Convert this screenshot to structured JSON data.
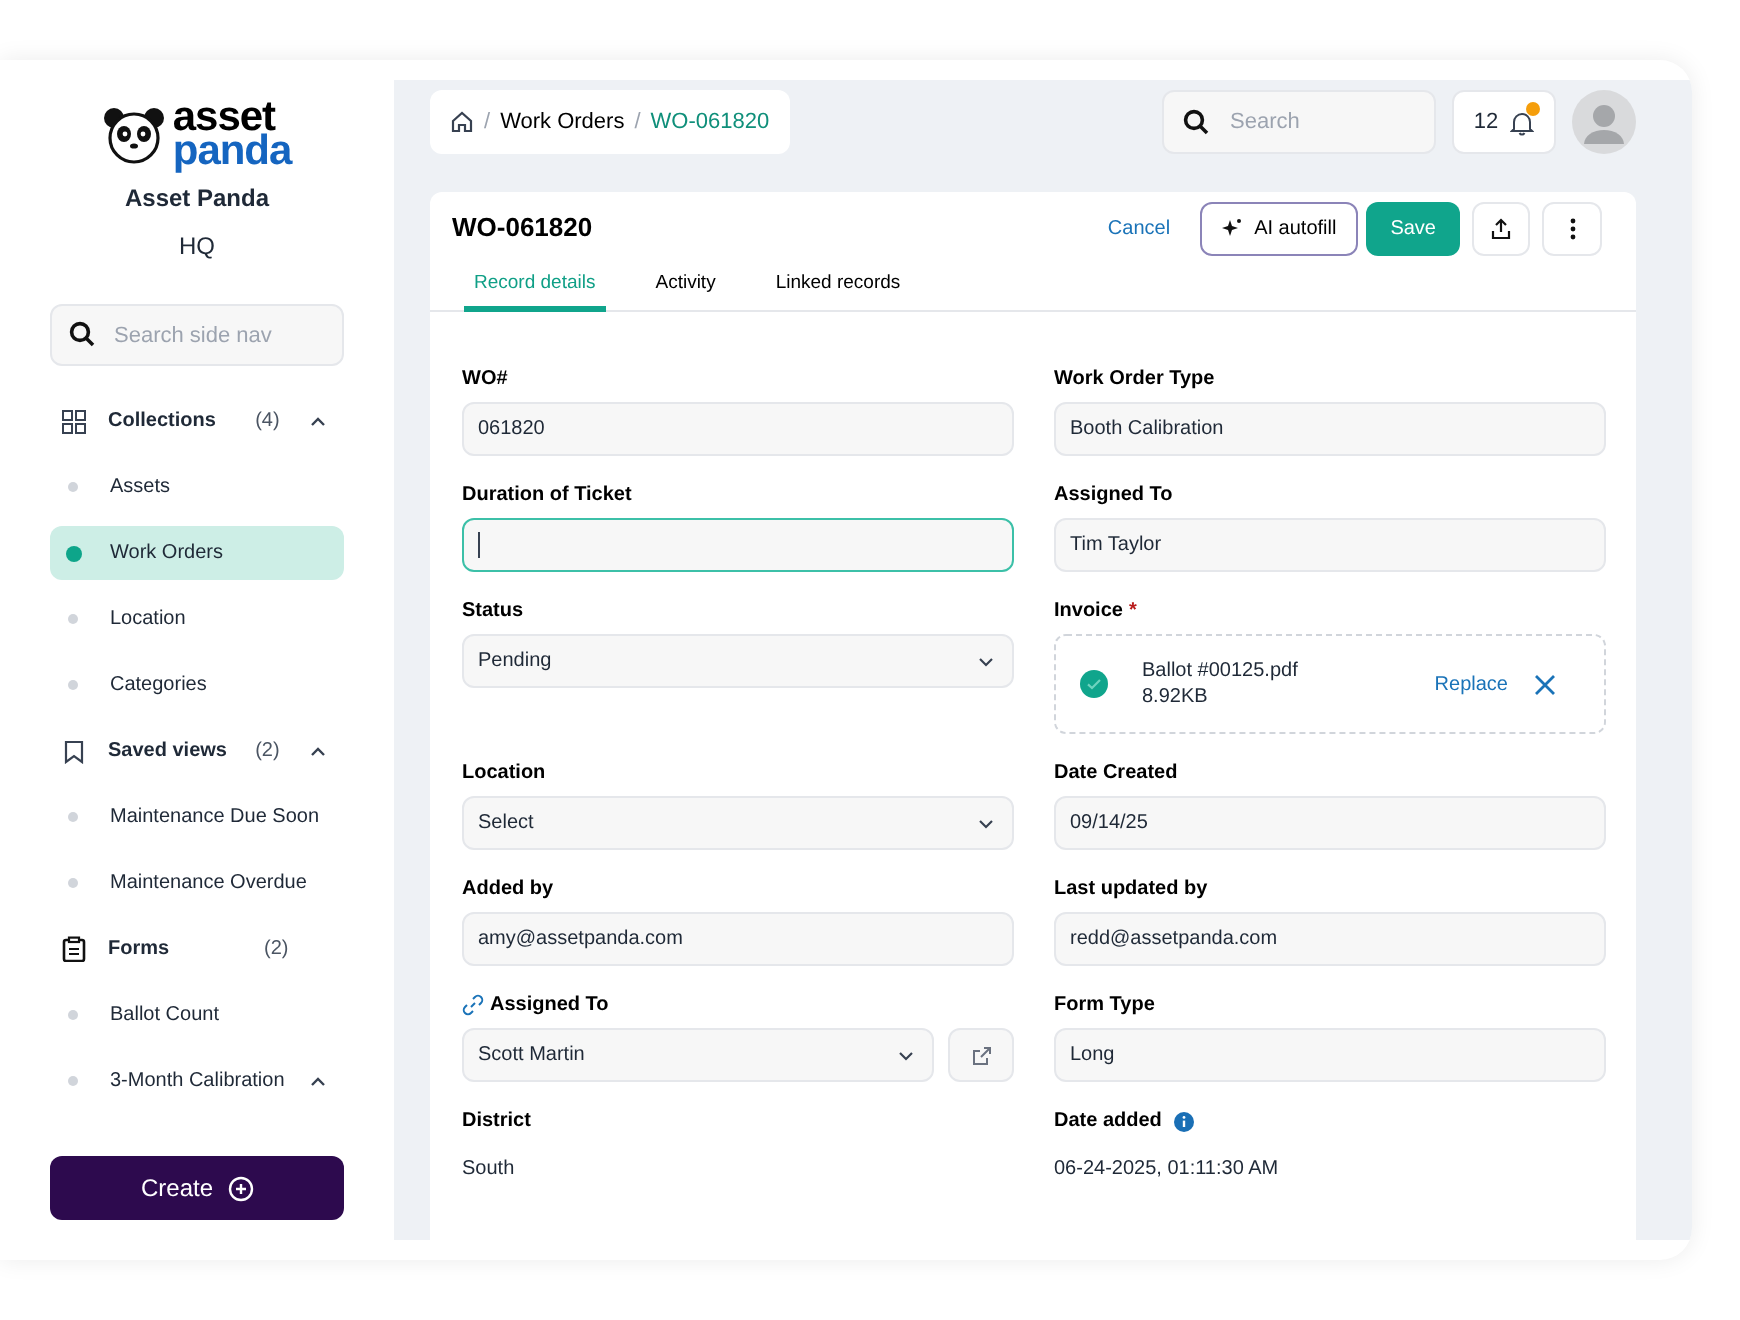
{
  "sidebar": {
    "logo": {
      "word_1": "asset",
      "word_2": "panda"
    },
    "org_name": "Asset Panda",
    "org_unit": "HQ",
    "search": {
      "placeholder": "Search side nav"
    },
    "groups": [
      {
        "label": "Collections",
        "count": "(4)",
        "toggle": true,
        "items": [
          {
            "label": "Assets",
            "selected": false,
            "toggle": false
          },
          {
            "label": "Work Orders",
            "selected": true,
            "toggle": false
          },
          {
            "label": "Location",
            "selected": false,
            "toggle": false
          },
          {
            "label": "Categories",
            "selected": false,
            "toggle": false
          }
        ]
      },
      {
        "label": "Saved views",
        "count": "(2)",
        "toggle": true,
        "items": [
          {
            "label": "Maintenance Due Soon",
            "selected": false,
            "toggle": false
          },
          {
            "label": "Maintenance Overdue",
            "selected": false,
            "toggle": false
          }
        ]
      },
      {
        "label": "Forms",
        "count": "(2)",
        "toggle": false,
        "items": [
          {
            "label": "Ballot Count",
            "selected": false,
            "toggle": false
          },
          {
            "label": "3-Month Calibration",
            "selected": false,
            "toggle": true
          }
        ]
      }
    ],
    "create_button": "Create"
  },
  "topbar": {
    "breadcrumb": [
      {
        "separator": "/",
        "label": "Work Orders"
      },
      {
        "separator": "/",
        "label": "WO-061820"
      }
    ],
    "search": {
      "placeholder": "Search"
    },
    "notifications": {
      "count": "12",
      "unread": true
    }
  },
  "record": {
    "title": "WO-061820",
    "actions": [
      {
        "kind": "link",
        "label": "Cancel"
      },
      {
        "kind": "outline",
        "label": "AI autofill"
      },
      {
        "kind": "primary",
        "label": "Save"
      }
    ],
    "tabs": [
      {
        "label": "Record details",
        "selected": true
      },
      {
        "label": "Activity",
        "selected": false
      },
      {
        "label": "Linked records",
        "selected": false
      }
    ],
    "fields": [
      {
        "kind": "input",
        "label": "WO#",
        "value": "061820"
      },
      {
        "kind": "input",
        "label": "Work Order Type",
        "value": "Booth Calibration"
      },
      {
        "kind": "input",
        "label": "Duration of Ticket",
        "focused": true
      },
      {
        "kind": "input",
        "label": "Assigned To",
        "value": "Tim Taylor"
      },
      {
        "kind": "select",
        "label": "Status",
        "value": "Pending"
      },
      {
        "kind": "file",
        "label": "Invoice",
        "required_mark": "*",
        "file_name": "Ballot #00125.pdf",
        "file_size": "8.92KB",
        "action": "Replace"
      },
      {
        "kind": "select",
        "label": "Location",
        "value": "Select"
      },
      {
        "kind": "input",
        "label": "Date Created",
        "value": "09/14/25"
      },
      {
        "kind": "input",
        "label": "Added by",
        "value": "amy@assetpanda.com"
      },
      {
        "kind": "input",
        "label": "Last updated by",
        "value": "redd@assetpanda.com"
      },
      {
        "kind": "select",
        "label": "Assigned To",
        "value": "Scott Martin",
        "linked": true
      },
      {
        "kind": "input",
        "label": "Form Type",
        "value": "Long"
      },
      {
        "kind": "text",
        "label": "District",
        "value": "South"
      },
      {
        "kind": "text",
        "label": "Date added",
        "value": "06-24-2025, 01:11:30 AM",
        "info": true
      }
    ]
  }
}
